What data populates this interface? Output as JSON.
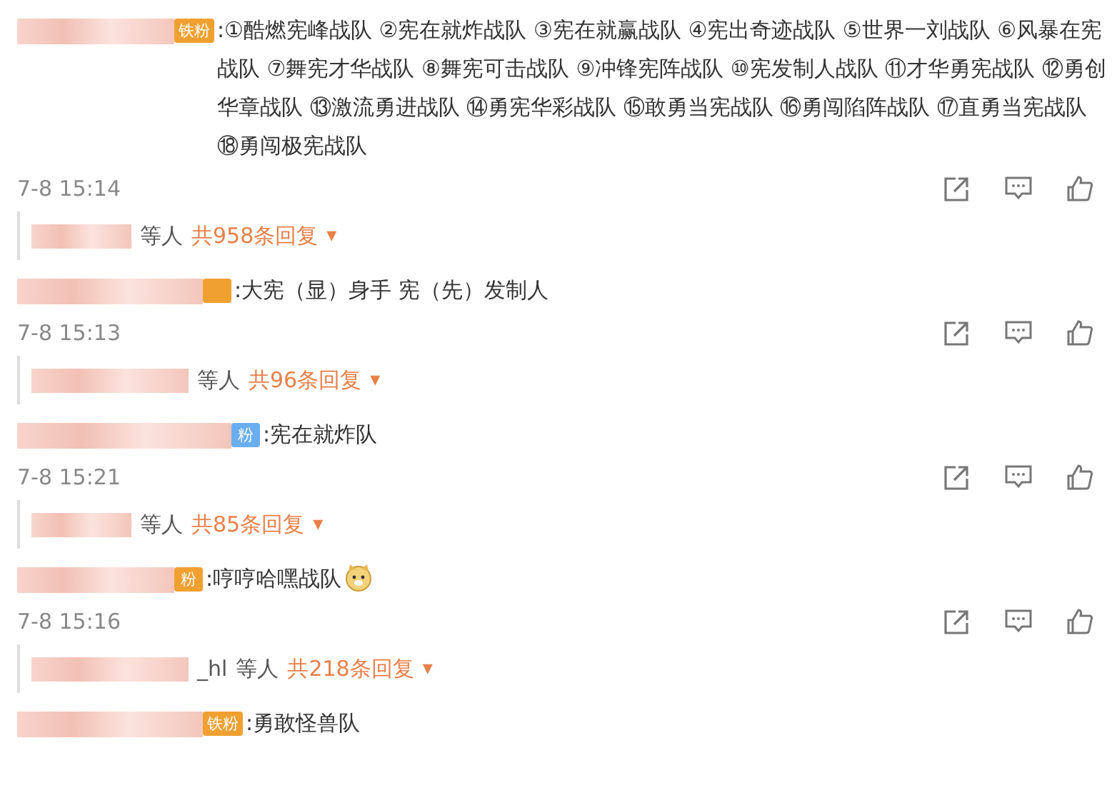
{
  "comments": [
    {
      "badge": "铁粉",
      "color": "#f0a030",
      "text": ":①酷燃宪峰战队 ②宪在就炸战队 ③宪在就赢战队 ④宪出奇迹战队 ⑤世界一刘战队 ⑥风暴在宪战队 ⑦舞宪才华战队 ⑧舞宪可击战队 ⑨冲锋宪阵战队 ⑩宪发制人战队 ⑪才华勇宪战队 ⑫勇创华章战队 ⑬激流勇进战队 ⑭勇宪华彩战队 ⑮敢勇当宪战队 ⑯勇闯陷阵战队 ⑰直勇当宪战队 ⑱勇闯极宪战队",
      "emoji": false,
      "time": "7-8 15:14",
      "reply": {
        "others": "等人",
        "count": "共958条回复",
        "caret": "▾"
      }
    },
    {
      "color": "#f0a030",
      "text": ":大宪（显）身手 宪（先）发制人",
      "emoji": false,
      "time": "7-8 15:13",
      "reply": {
        "others": "等人",
        "count": "共96条回复",
        "caret": "▾"
      }
    },
    {
      "badge": "粉",
      "color": "#6aaef0",
      "text": ":宪在就炸队",
      "emoji": false,
      "time": "7-8 15:21",
      "reply": {
        "others": "等人",
        "count": "共85条回复",
        "caret": "▾"
      }
    },
    {
      "badge": "粉",
      "color": "#f0a030",
      "text": ":哼哼哈嘿战队",
      "emoji": true,
      "time": "7-8 15:16",
      "reply": {
        "name_tail": "_hl",
        "others": "等人",
        "count": "共218条回复",
        "caret": "▾"
      }
    },
    {
      "badge": "铁粉",
      "color": "#f0a030",
      "text": ":勇敢怪兽队",
      "emoji": false
    }
  ]
}
